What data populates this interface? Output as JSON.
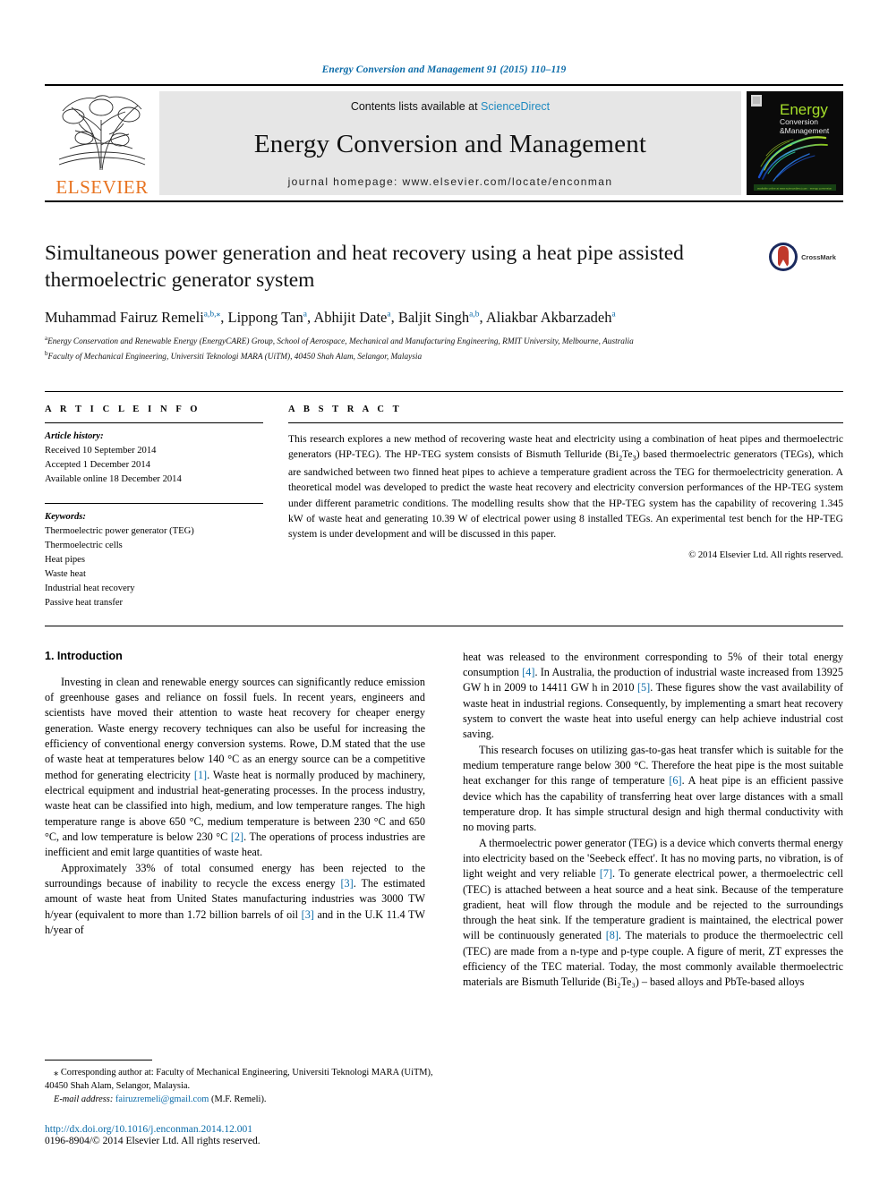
{
  "running_head": "Energy Conversion and Management 91 (2015) 110–119",
  "masthead": {
    "publisher_name": "ELSEVIER",
    "contents_prefix": "Contents lists available at ",
    "sciencedirect": "ScienceDirect",
    "journal_title": "Energy Conversion and Management",
    "homepage": "journal homepage: www.elsevier.com/locate/enconman",
    "cover": {
      "line1": "Energy",
      "line2": "Conversion",
      "line3": "Management",
      "line3_prefix": "&",
      "footer_text": "available online at www.sciencedirect.com  •  energy conversion"
    }
  },
  "article": {
    "title": "Simultaneous power generation and heat recovery using a heat pipe assisted thermoelectric generator system",
    "crossmark_label": "CrossMark",
    "authors": [
      {
        "name": "Muhammad Fairuz Remeli",
        "marks": "a,b,",
        "star": true
      },
      {
        "name": "Lippong Tan",
        "marks": "a"
      },
      {
        "name": "Abhijit Date",
        "marks": "a"
      },
      {
        "name": "Baljit Singh",
        "marks": "a,b"
      },
      {
        "name": "Aliakbar Akbarzadeh",
        "marks": "a"
      }
    ],
    "affiliations": [
      {
        "mark": "a",
        "text": "Energy Conservation and Renewable Energy (EnergyCARE) Group, School of Aerospace, Mechanical and Manufacturing Engineering, RMIT University, Melbourne, Australia"
      },
      {
        "mark": "b",
        "text": "Faculty of Mechanical Engineering, Universiti Teknologi MARA (UiTM), 40450 Shah Alam, Selangor, Malaysia"
      }
    ]
  },
  "article_info": {
    "heading": "A R T I C L E    I N F O",
    "history_label": "Article history:",
    "history": [
      "Received 10 September 2014",
      "Accepted 1 December 2014",
      "Available online 18 December 2014"
    ],
    "keywords_label": "Keywords:",
    "keywords": [
      "Thermoelectric power generator (TEG)",
      "Thermoelectric cells",
      "Heat pipes",
      "Waste heat",
      "Industrial heat recovery",
      "Passive heat transfer"
    ]
  },
  "abstract": {
    "heading": "A B S T R A C T",
    "text_part1": "This research explores a new method of recovering waste heat and electricity using a combination of heat pipes and thermoelectric generators (HP-TEG). The HP-TEG system consists of Bismuth Telluride (Bi",
    "formula_sub1": "2",
    "text_part2": "Te",
    "formula_sub2": "3",
    "text_part3": ") based thermoelectric generators (TEGs), which are sandwiched between two finned heat pipes to achieve a temperature gradient across the TEG for thermoelectricity generation. A theoretical model was developed to predict the waste heat recovery and electricity conversion performances of the HP-TEG system under different parametric conditions. The modelling results show that the HP-TEG system has the capability of recovering 1.345 kW of waste heat and generating 10.39 W of electrical power using 8 installed TEGs. An experimental test bench for the HP-TEG system is under development and will be discussed in this paper.",
    "copyright": "© 2014 Elsevier Ltd. All rights reserved."
  },
  "body": {
    "section_title": "1. Introduction",
    "left_paragraphs": [
      {
        "parts": [
          {
            "t": "Investing in clean and renewable energy sources can significantly reduce emission of greenhouse gases and reliance on fossil fuels. In recent years, engineers and scientists have moved their attention to waste heat recovery for cheaper energy generation. Waste energy recovery techniques can also be useful for increasing the efficiency of conventional energy conversion systems. Rowe, D.M stated that the use of waste heat at temperatures below 140 °C as an energy source can be a competitive method for generating electricity "
          },
          {
            "t": "[1]",
            "ref": true
          },
          {
            "t": ". Waste heat is normally produced by machinery, electrical equipment and industrial heat-generating processes. In the process industry, waste heat can be classified into high, medium, and low temperature ranges. The high temperature range is above 650 °C, medium temperature is between 230 °C and 650 °C, and low temperature is below 230 °C "
          },
          {
            "t": "[2]",
            "ref": true
          },
          {
            "t": ". The operations of process industries are inefficient and emit large quantities of waste heat."
          }
        ]
      },
      {
        "parts": [
          {
            "t": "Approximately 33% of total consumed energy has been rejected to the surroundings because of inability to recycle the excess energy "
          },
          {
            "t": "[3]",
            "ref": true
          },
          {
            "t": ". The estimated amount of waste heat from United States manufacturing industries was 3000 TW h/year (equivalent to more than 1.72 billion barrels of oil "
          },
          {
            "t": "[3]",
            "ref": true
          },
          {
            "t": " and in the U.K 11.4 TW h/year of"
          }
        ]
      }
    ],
    "right_paragraphs": [
      {
        "continuation": true,
        "parts": [
          {
            "t": "heat was released to the environment corresponding to 5% of their total energy consumption "
          },
          {
            "t": "[4]",
            "ref": true
          },
          {
            "t": ". In Australia, the production of industrial waste increased from 13925 GW h in 2009 to 14411 GW h in 2010 "
          },
          {
            "t": "[5]",
            "ref": true
          },
          {
            "t": ". These figures show the vast availability of waste heat in industrial regions. Consequently, by implementing a smart heat recovery system to convert the waste heat into useful energy can help achieve industrial cost saving."
          }
        ]
      },
      {
        "parts": [
          {
            "t": "This research focuses on utilizing gas-to-gas heat transfer which is suitable for the medium temperature range below 300 °C. Therefore the heat pipe is the most suitable heat exchanger for this range of temperature "
          },
          {
            "t": "[6]",
            "ref": true
          },
          {
            "t": ". A heat pipe is an efficient passive device which has the capability of transferring heat over large distances with a small temperature drop. It has simple structural design and high thermal conductivity with no moving parts."
          }
        ]
      },
      {
        "parts": [
          {
            "t": "A thermoelectric power generator (TEG) is a device which converts thermal energy into electricity based on the 'Seebeck effect'. It has no moving parts, no vibration, is of light weight and very reliable "
          },
          {
            "t": "[7]",
            "ref": true
          },
          {
            "t": ". To generate electrical power, a thermoelectric cell (TEC) is attached between a heat source and a heat sink. Because of the temperature gradient, heat will flow through the module and be rejected to the surroundings through the heat sink. If the temperature gradient is maintained, the electrical power will be continuously generated "
          },
          {
            "t": "[8]",
            "ref": true
          },
          {
            "t": ". The materials to produce the thermoelectric cell (TEC) are made from a n-type and p-type couple. A figure of merit, ZT expresses the efficiency of the TEC material. Today, the most commonly available thermoelectric materials are Bismuth Telluride (Bi₂Te₃) – based alloys and PbTe-based alloys"
          }
        ]
      }
    ]
  },
  "footnotes": {
    "corresponding_mark": "⁎",
    "corresponding_text": "Corresponding author at: Faculty of Mechanical Engineering, Universiti Teknologi MARA (UiTM), 40450 Shah Alam, Selangor, Malaysia.",
    "email_label": "E-mail address:",
    "email": "fairuzremeli@gmail.com",
    "email_suffix": "(M.F. Remeli).",
    "doi": "http://dx.doi.org/10.1016/j.enconman.2014.12.001",
    "issn_line": "0196-8904/© 2014 Elsevier Ltd. All rights reserved."
  },
  "colors": {
    "link_blue": "#0b6ba8",
    "sciencedirect_blue": "#1f8ac0",
    "elsevier_orange": "#e87422",
    "masthead_gray": "#e6e6e6"
  }
}
